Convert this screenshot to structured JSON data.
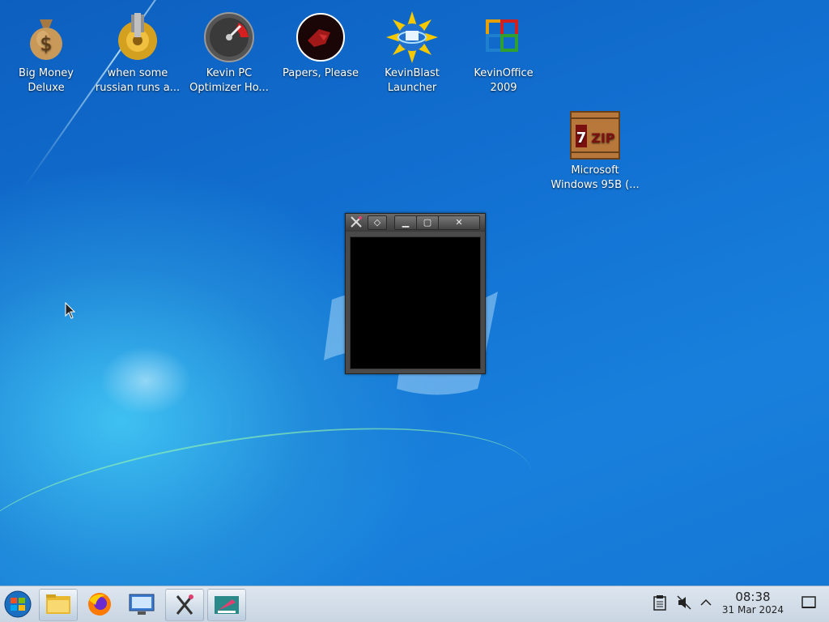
{
  "desktop": {
    "icons": [
      {
        "label": "Big Money\nDeluxe",
        "icon": "money-bag-icon"
      },
      {
        "label": "when some\nrussian runs a...",
        "icon": "gear-icon"
      },
      {
        "label": "Kevin PC\nOptimizer Ho...",
        "icon": "speedometer-icon"
      },
      {
        "label": "Papers, Please",
        "icon": "papers-please-icon"
      },
      {
        "label": "KevinBlast\nLauncher",
        "icon": "globe-disc-icon"
      },
      {
        "label": "KevinOffice\n2009",
        "icon": "office-icon"
      },
      {
        "label": "Microsoft\nWindows 95B (...",
        "icon": "7zip-crate-icon"
      }
    ]
  },
  "window": {
    "title_buttons": [
      "✕",
      "◇",
      "▁",
      "▢",
      "✕"
    ]
  },
  "taskbar": {
    "items": [
      "start-orb-icon",
      "file-manager-icon",
      "firefox-icon",
      "control-panel-icon",
      "x-terminal-icon",
      "paint-icon"
    ],
    "clock": {
      "time": "08:38",
      "date": "31 Mar 2024"
    },
    "tray": [
      "clipboard-icon",
      "volume-muted-icon",
      "chevron-up-icon",
      "show-desktop-icon"
    ]
  }
}
